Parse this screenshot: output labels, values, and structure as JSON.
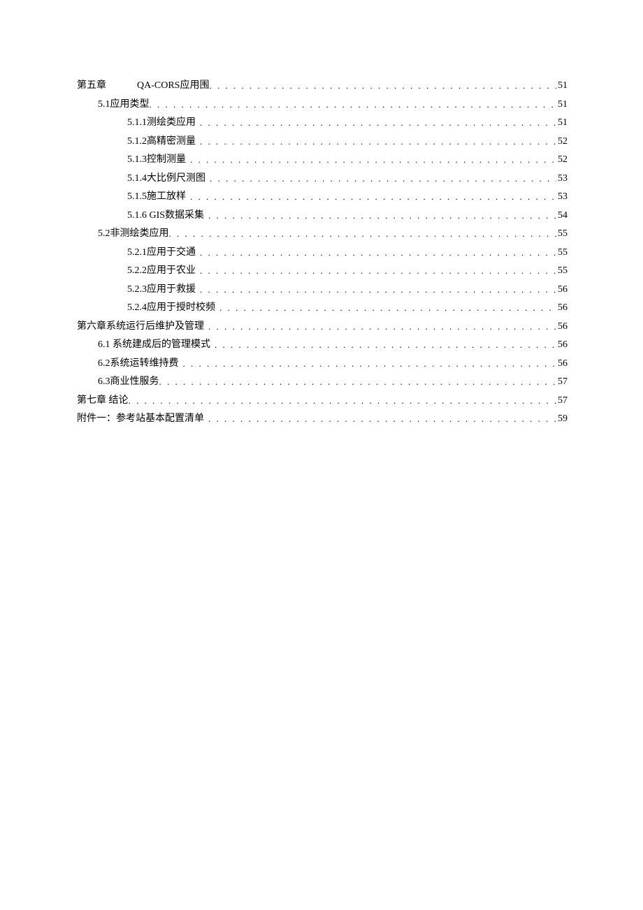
{
  "toc": [
    {
      "indent": 0,
      "prefix": "第五章",
      "spacedTitle": "QA-CORS应用围",
      "page": "51"
    },
    {
      "indent": 1,
      "label": "5.1应用类型",
      "page": "51",
      "gap": false
    },
    {
      "indent": 2,
      "label": "5.1.1测绘类应用",
      "page": "51",
      "gap": true
    },
    {
      "indent": 2,
      "label": "5.1.2高精密测量",
      "page": "52",
      "gap": true
    },
    {
      "indent": 2,
      "label": "5.1.3控制测量",
      "page": "52",
      "gap": true
    },
    {
      "indent": 2,
      "label": "5.1.4大比例尺测图",
      "page": "53",
      "gap": true
    },
    {
      "indent": 2,
      "label": "5.1.5施工放样",
      "page": "53",
      "gap": true
    },
    {
      "indent": 2,
      "label": "5.1.6 GIS数据采集",
      "page": "54",
      "gap": true
    },
    {
      "indent": 1,
      "label": "5.2非测绘类应用",
      "page": "55",
      "gap": false
    },
    {
      "indent": 2,
      "label": "5.2.1应用于交通",
      "page": "55",
      "gap": true
    },
    {
      "indent": 2,
      "label": "5.2.2应用于农业",
      "page": "55",
      "gap": true
    },
    {
      "indent": 2,
      "label": "5.2.3应用于救援",
      "page": "56",
      "gap": true
    },
    {
      "indent": 2,
      "label": "5.2.4应用于授时校频",
      "page": "56",
      "gap": true
    },
    {
      "indent": 0,
      "label": "第六章系统运行后维护及管理",
      "page": "56",
      "gap": true
    },
    {
      "indent": 1,
      "label": "6.1  系统建成后的管理模式",
      "page": "56",
      "gap": true
    },
    {
      "indent": 1,
      "label": "6.2系统运转维持费",
      "page": "56",
      "gap": true
    },
    {
      "indent": 1,
      "label": "6.3商业性服务",
      "page": "57",
      "gap": false
    },
    {
      "indent": 0,
      "label": "第七章 结论",
      "page": "57",
      "gap": false
    },
    {
      "indent": 0,
      "label": "附件一：参考站基本配置清单",
      "page": "59",
      "gap": true
    }
  ]
}
